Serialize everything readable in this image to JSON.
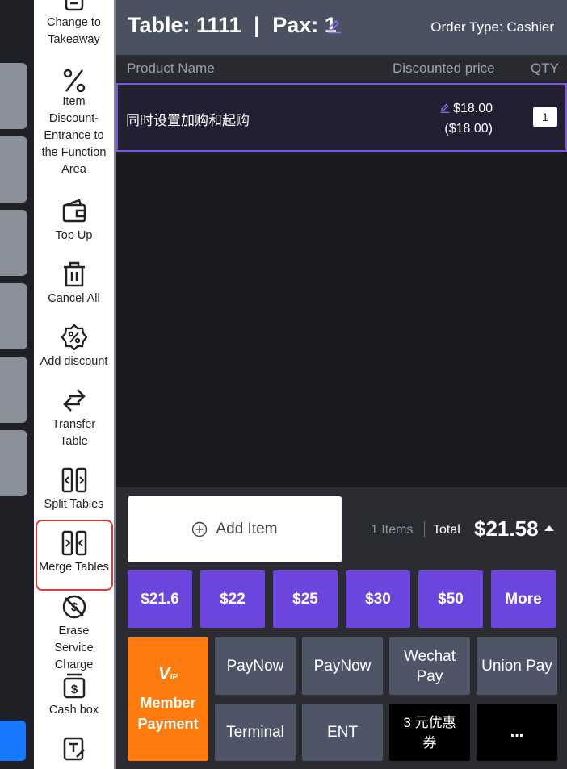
{
  "sidebar": {
    "items": [
      {
        "label": "Change to Takeaway",
        "icon": "takeaway-icon"
      },
      {
        "label": "Item Discount-Entrance to the Function Area",
        "icon": "percent-icon"
      },
      {
        "label": "Top Up",
        "icon": "wallet-icon"
      },
      {
        "label": "Cancel All",
        "icon": "trash-icon"
      },
      {
        "label": "Add discount",
        "icon": "discount-badge-icon"
      },
      {
        "label": "Transfer Table",
        "icon": "transfer-arrows-icon"
      },
      {
        "label": "Split Tables",
        "icon": "split-tables-icon"
      },
      {
        "label": "Merge Tables",
        "icon": "merge-tables-icon"
      },
      {
        "label": "Erase Service Charge",
        "icon": "erase-charge-icon"
      },
      {
        "label": "Cash box",
        "icon": "cash-box-icon"
      },
      {
        "label": "",
        "icon": "edit-note-icon"
      }
    ]
  },
  "header": {
    "table_label": "Table: 1111",
    "separator": "|",
    "pax_label": "Pax: 1",
    "order_type": "Order Type: Cashier"
  },
  "columns": {
    "product_name": "Product Name",
    "discounted_price": "Discounted price",
    "qty": "QTY"
  },
  "order_items": [
    {
      "name": "同时设置加购和起购",
      "price": "$18.00",
      "original_price": "($18.00)",
      "qty": "1"
    }
  ],
  "summary": {
    "add_item": "Add Item",
    "items_count": "1 Items",
    "total_label": "Total",
    "total_value": "$21.58"
  },
  "quick_amounts": [
    "$21.6",
    "$22",
    "$25",
    "$30",
    "$50",
    "More"
  ],
  "payment": {
    "member": {
      "vip": "V",
      "vip_sub": "IP",
      "label": "Member Payment"
    },
    "methods": [
      "PayNow",
      "PayNow",
      "Wechat Pay",
      "Union Pay",
      "Terminal",
      "ENT",
      "3 元优惠券",
      "..."
    ]
  },
  "colors": {
    "accent": "#6b45dd",
    "member": "#fe7b0d",
    "highlight": "#e53935",
    "header_bg": "#4a5161",
    "pay_button": "#4d5566"
  }
}
